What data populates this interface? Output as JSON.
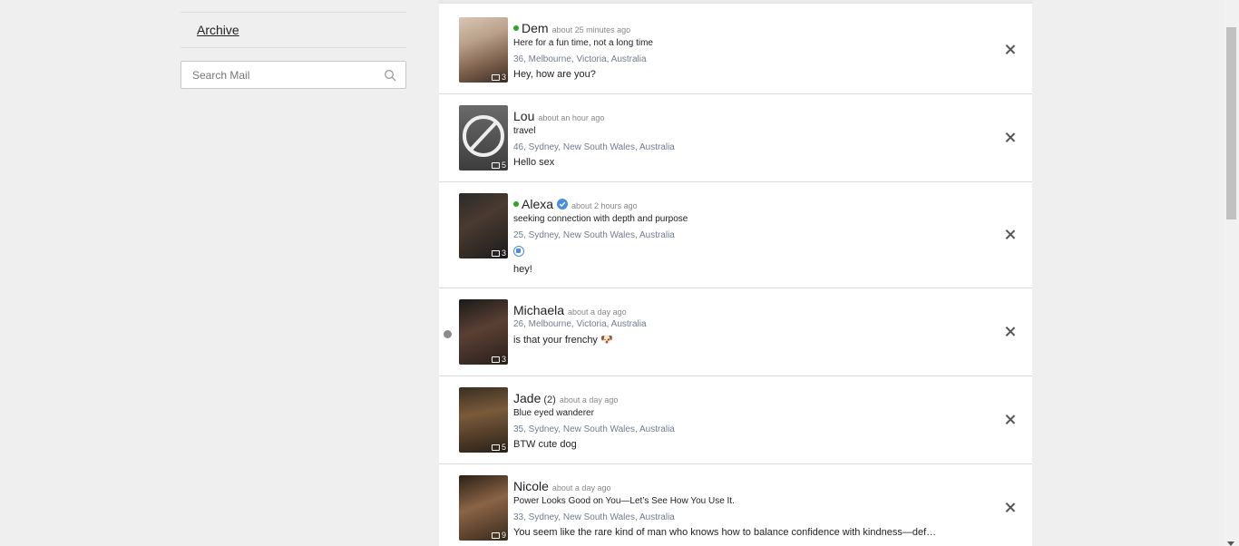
{
  "sidebar": {
    "archive_label": "Archive",
    "search_placeholder": "Search Mail"
  },
  "messages": [
    {
      "name": "Dem",
      "online": true,
      "verified": false,
      "count": "",
      "time": "about 25 minutes ago",
      "tagline": "Here for a fun time, not a long time",
      "location": "36, Melbourne, Victoria, Australia",
      "message": "Hey, how are you?",
      "photos": "3",
      "unread": false
    },
    {
      "name": "Lou",
      "online": false,
      "verified": false,
      "count": "",
      "time": "about an hour ago",
      "tagline": "travel",
      "location": "46, Sydney, New South Wales, Australia",
      "message": "Hello sex",
      "photos": "5",
      "unread": false
    },
    {
      "name": "Alexa",
      "online": true,
      "verified": true,
      "count": "",
      "time": "about 2 hours ago",
      "tagline": "seeking connection with depth and purpose",
      "location": "25, Sydney, New South Wales, Australia",
      "message": "hey!",
      "photos": "3",
      "unread": false
    },
    {
      "name": "Michaela",
      "online": false,
      "verified": false,
      "count": "",
      "time": "about a day ago",
      "tagline": "",
      "location": "26, Melbourne, Victoria, Australia",
      "message": "is that your frenchy 🐶",
      "photos": "3",
      "unread": true
    },
    {
      "name": "Jade",
      "online": false,
      "verified": false,
      "count": "(2)",
      "time": "about a day ago",
      "tagline": "Blue eyed wanderer",
      "location": "35, Sydney, New South Wales, Australia",
      "message": "BTW cute dog",
      "photos": "5",
      "unread": false
    },
    {
      "name": "Nicole",
      "online": false,
      "verified": false,
      "count": "",
      "time": "about a day ago",
      "tagline": "Power Looks Good on You—Let’s See How You Use It.",
      "location": "33, Sydney, New South Wales, Australia",
      "message": "You seem like the rare kind of man who knows how to balance confidence with kindness—def…",
      "photos": "9",
      "unread": false
    }
  ],
  "colors": {
    "online": "#2aa52a",
    "verified": "#4a90d9",
    "location": "#6e7d8f"
  }
}
